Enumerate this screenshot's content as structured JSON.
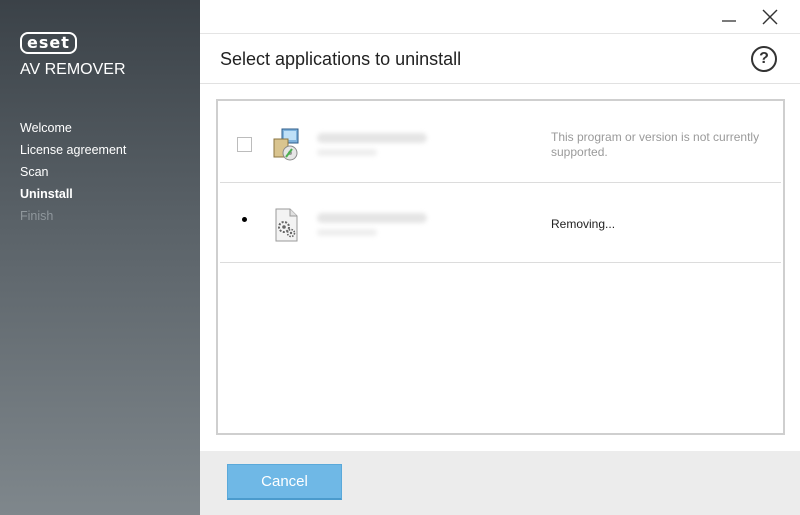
{
  "sidebar": {
    "logo_text": "eset",
    "product_name": "AV REMOVER",
    "steps": [
      {
        "label": "Welcome",
        "state": "done"
      },
      {
        "label": "License agreement",
        "state": "done"
      },
      {
        "label": "Scan",
        "state": "done"
      },
      {
        "label": "Uninstall",
        "state": "active"
      },
      {
        "label": "Finish",
        "state": "disabled"
      }
    ]
  },
  "window": {
    "minimize_icon": "minimize-icon",
    "close_icon": "close-icon"
  },
  "header": {
    "title": "Select applications to uninstall",
    "help_label": "?"
  },
  "applications": [
    {
      "icon": "installer-package-icon",
      "status": "This program or version is not currently supported.",
      "selectable": true,
      "checked": false
    },
    {
      "icon": "settings-file-icon",
      "status": "Removing...",
      "selectable": false
    }
  ],
  "footer": {
    "cancel_label": "Cancel"
  },
  "colors": {
    "accent": "#6fb8e6",
    "sidebar_top": "#3b4248",
    "sidebar_bottom": "#7f878c",
    "disabled_text": "#8f979c"
  }
}
